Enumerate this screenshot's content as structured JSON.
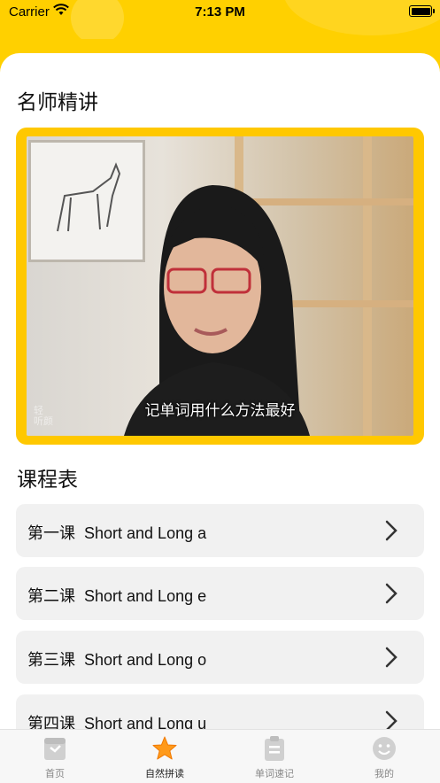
{
  "status_bar": {
    "carrier": "Carrier",
    "time": "7:13 PM"
  },
  "sections": {
    "teacher_title": "名师精讲",
    "schedule_title": "课程表"
  },
  "video": {
    "caption": "记单词用什么方法最好",
    "watermark": "轻\n听颜"
  },
  "lessons": [
    {
      "label": "第一课  Short and Long a"
    },
    {
      "label": "第二课  Short and Long e"
    },
    {
      "label": "第三课  Short and Long o"
    },
    {
      "label": "第四课  Short and Long u"
    }
  ],
  "tab_bar": {
    "tabs": [
      {
        "label": "首页",
        "icon": "home-calendar-icon"
      },
      {
        "label": "自然拼读",
        "icon": "star-icon"
      },
      {
        "label": "单词速记",
        "icon": "clipboard-icon"
      },
      {
        "label": "我的",
        "icon": "smiley-icon"
      }
    ],
    "active_index": 1
  },
  "colors": {
    "accent": "#ffd000",
    "card_bg": "#f1f1f1",
    "star": "#ff9a1a"
  }
}
